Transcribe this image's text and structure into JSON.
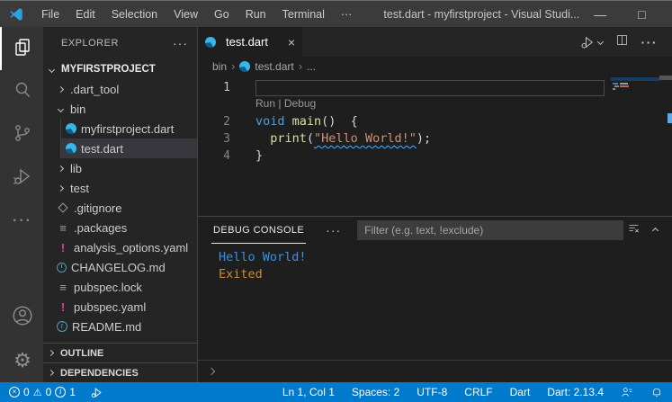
{
  "titlebar": {
    "menus": [
      "File",
      "Edit",
      "Selection",
      "View",
      "Go",
      "Run",
      "Terminal"
    ],
    "menu_overflow": "···",
    "title": "test.dart - myfirstproject - Visual Studi...",
    "minimize": "—",
    "maximize": "□",
    "close": "×"
  },
  "activity_bar": {
    "items": [
      "explorer",
      "search",
      "source-control",
      "run-and-debug",
      "more-views"
    ],
    "bottom_items": [
      "account",
      "manage-settings"
    ],
    "more_glyph": "···",
    "gear_glyph": "⚙"
  },
  "sidebar": {
    "header": "EXPLORER",
    "header_more": "···",
    "root": "MYFIRSTPROJECT",
    "files": [
      {
        "label": ".dart_tool"
      },
      {
        "label": "bin"
      },
      {
        "label": "myfirstproject.dart"
      },
      {
        "label": "test.dart"
      },
      {
        "label": "lib"
      },
      {
        "label": "test"
      },
      {
        "label": ".gitignore"
      },
      {
        "label": ".packages"
      },
      {
        "label": "analysis_options.yaml"
      },
      {
        "label": "CHANGELOG.md"
      },
      {
        "label": "pubspec.lock"
      },
      {
        "label": "pubspec.yaml"
      },
      {
        "label": "README.md"
      }
    ],
    "bottom_sections": [
      "OUTLINE",
      "DEPENDENCIES"
    ],
    "glyphs": {
      "config_lines": "≡",
      "yaml_bang": "!",
      "info_i": "i"
    }
  },
  "editor": {
    "tab": {
      "label": "test.dart",
      "close": "×"
    },
    "breadcrumb": {
      "part1": "bin",
      "sep": "›",
      "part2": "test.dart",
      "part3": "..."
    },
    "line_numbers": [
      "1",
      "2",
      "3",
      "4"
    ],
    "codelens": {
      "run": "Run",
      "sep": " | ",
      "debug": "Debug"
    },
    "code": {
      "l2_kw": "void",
      "l2_sp": " ",
      "l2_fn": "main",
      "l2_rest": "()  {",
      "l3_indent": "  ",
      "l3_fn": "print",
      "l3_open": "(",
      "l3_str": "\"Hello World!\"",
      "l3_close": ");",
      "l4": "}"
    }
  },
  "panel": {
    "tab": "DEBUG CONSOLE",
    "more": "···",
    "filter_placeholder": "Filter (e.g. text, !exclude)",
    "output": [
      {
        "text": "Hello World!"
      },
      {
        "text": "Exited"
      }
    ]
  },
  "status_bar": {
    "error_count": "0",
    "warning_count": "0",
    "info_count": "1",
    "error_glyph": "×",
    "warning_glyph": "⚠",
    "info_glyph": "i",
    "items": [
      "Ln 1, Col 1",
      "Spaces: 2",
      "UTF-8",
      "CRLF",
      "Dart",
      "Dart: 2.13.4"
    ]
  },
  "colors": {
    "status_bar": "#007acc",
    "keyword": "#569cd6",
    "function": "#dcdcaa",
    "string": "#ce9178",
    "console_stdout": "#3b8eea",
    "console_exit": "#cd8a2e",
    "squiggle_info": "#4fb0ff",
    "yaml_icon": "#d8439b",
    "blue_file_icon": "#519aba",
    "dart_icon": "#38b6e8",
    "selected_row_bg": "#37373d"
  }
}
